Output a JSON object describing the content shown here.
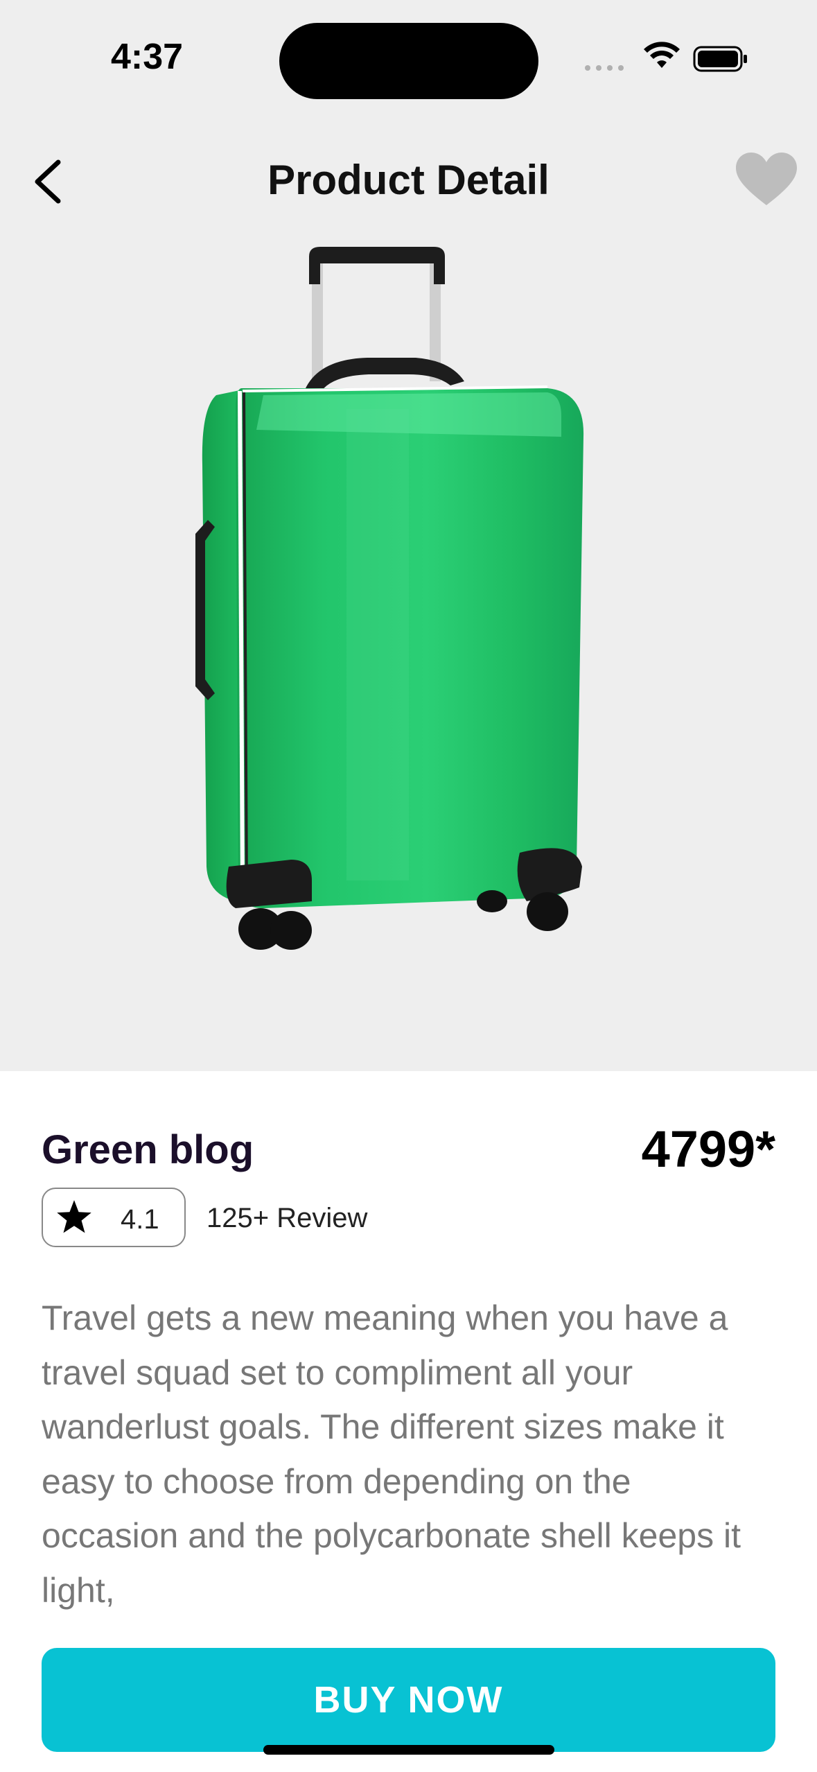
{
  "status_bar": {
    "time": "4:37"
  },
  "header": {
    "title": "Product Detail"
  },
  "product": {
    "name": "Green blog",
    "price": "4799*",
    "rating": "4.1",
    "reviews": "125+ Review",
    "description": "Travel gets a new meaning when you have a travel squad set to compliment all your wanderlust goals. The different sizes make it easy to choose from depending on the occasion and the polycarbonate shell keeps it light,",
    "color": "#1fc26a"
  },
  "actions": {
    "buy_label": "BUY NOW"
  },
  "colors": {
    "accent": "#08c2d3",
    "hero_bg": "#eeeeee",
    "favorite_icon": "#bdbdbd"
  },
  "icons": [
    "back-chevron-icon",
    "heart-icon",
    "star-icon",
    "wifi-icon",
    "battery-icon"
  ]
}
